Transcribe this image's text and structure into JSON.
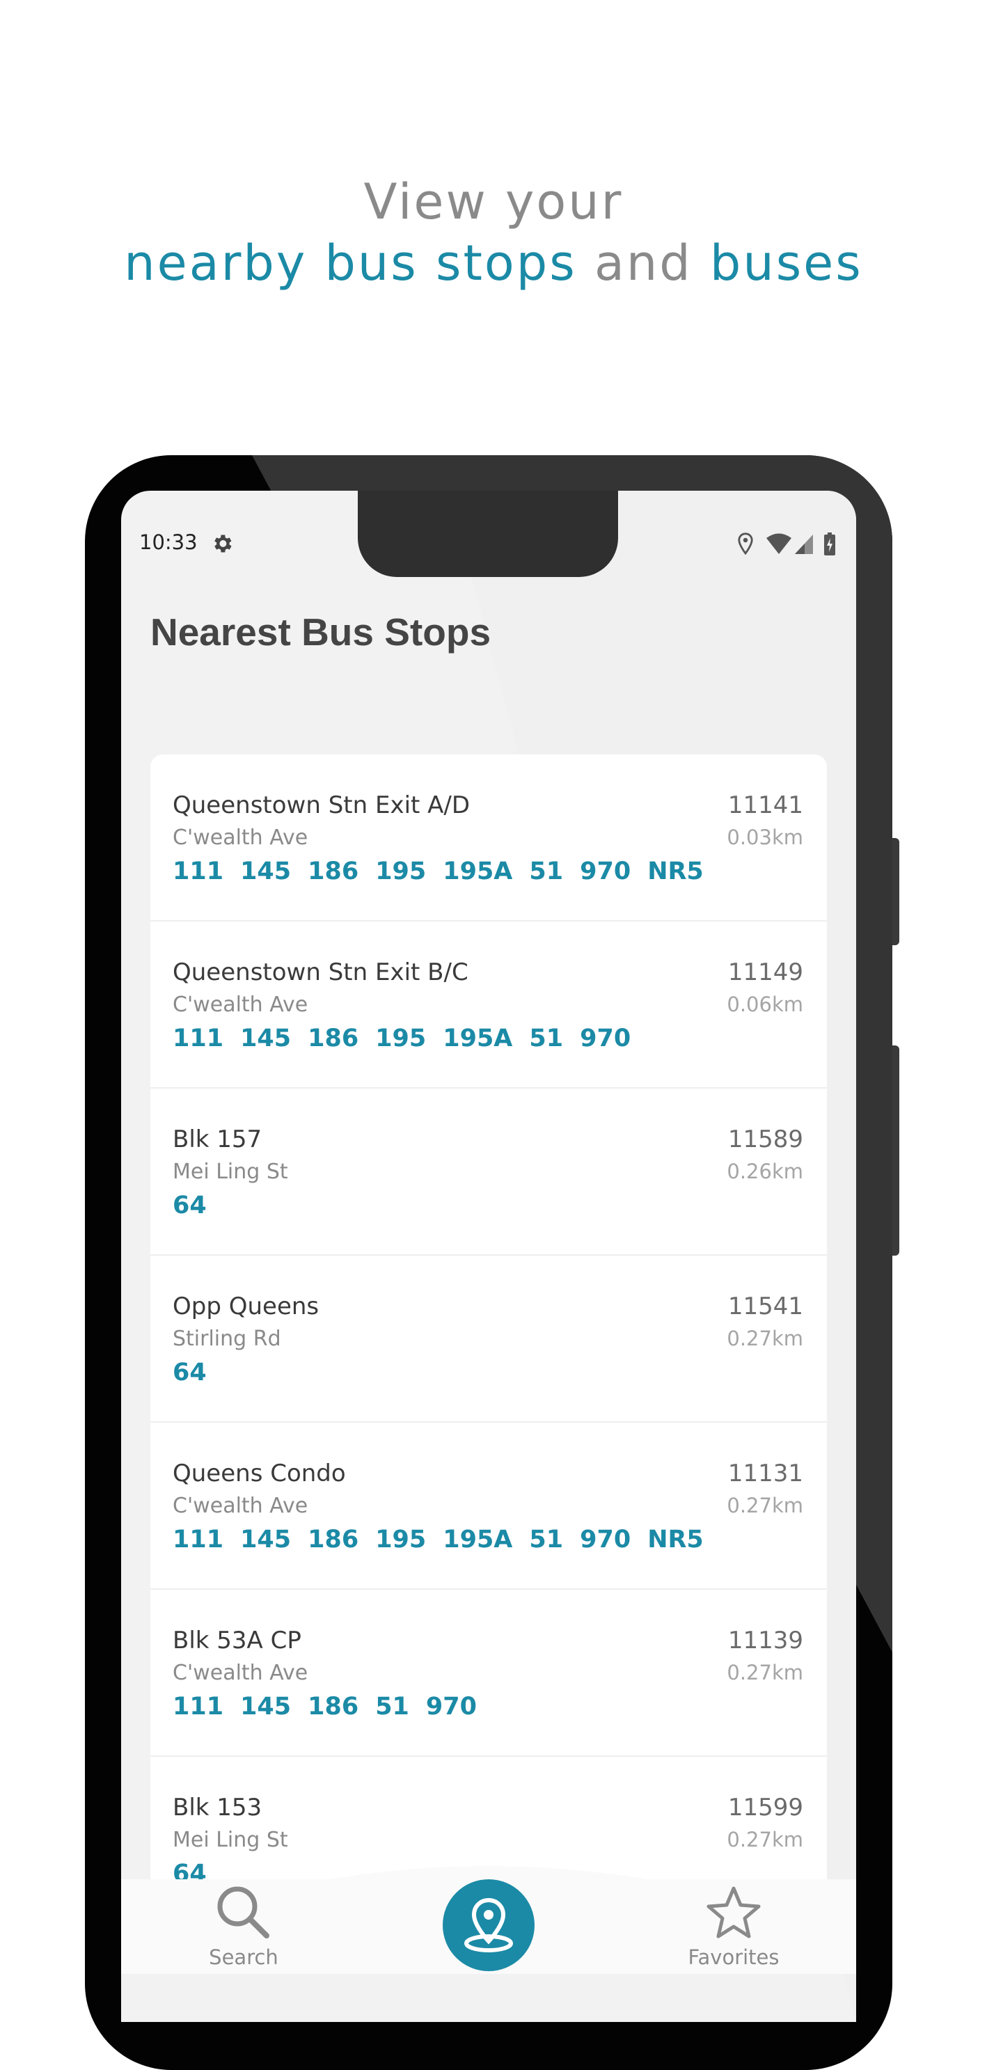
{
  "headline": {
    "line1": "View your",
    "part_nearby": "nearby bus stops",
    "part_and": "and",
    "part_buses": "buses"
  },
  "status_bar": {
    "time": "10:33"
  },
  "app": {
    "title": "Nearest Bus Stops"
  },
  "stops": [
    {
      "name": "Queenstown Stn Exit A/D",
      "road": "C'wealth Ave",
      "code": "11141",
      "distance": "0.03km",
      "routes": [
        "111",
        "145",
        "186",
        "195",
        "195A",
        "51",
        "970",
        "NR5"
      ]
    },
    {
      "name": "Queenstown Stn Exit B/C",
      "road": "C'wealth Ave",
      "code": "11149",
      "distance": "0.06km",
      "routes": [
        "111",
        "145",
        "186",
        "195",
        "195A",
        "51",
        "970"
      ]
    },
    {
      "name": "Blk 157",
      "road": "Mei Ling St",
      "code": "11589",
      "distance": "0.26km",
      "routes": [
        "64"
      ]
    },
    {
      "name": "Opp Queens",
      "road": "Stirling Rd",
      "code": "11541",
      "distance": "0.27km",
      "routes": [
        "64"
      ]
    },
    {
      "name": "Queens Condo",
      "road": "C'wealth Ave",
      "code": "11131",
      "distance": "0.27km",
      "routes": [
        "111",
        "145",
        "186",
        "195",
        "195A",
        "51",
        "970",
        "NR5"
      ]
    },
    {
      "name": "Blk 53A CP",
      "road": "C'wealth Ave",
      "code": "11139",
      "distance": "0.27km",
      "routes": [
        "111",
        "145",
        "186",
        "51",
        "970"
      ]
    },
    {
      "name": "Blk 153",
      "road": "Mei Ling St",
      "code": "11599",
      "distance": "0.27km",
      "routes": [
        "64"
      ]
    }
  ],
  "bottom_nav": {
    "search_label": "Search",
    "favorites_label": "Favorites"
  },
  "colors": {
    "accent": "#1b8aa6",
    "headline_gray": "#8a8a8a",
    "phone_body": "#030303"
  },
  "icons": [
    "gear-icon",
    "location-icon",
    "wifi-icon",
    "signal-icon",
    "battery-icon",
    "search-icon",
    "map-pin-icon",
    "star-icon"
  ]
}
